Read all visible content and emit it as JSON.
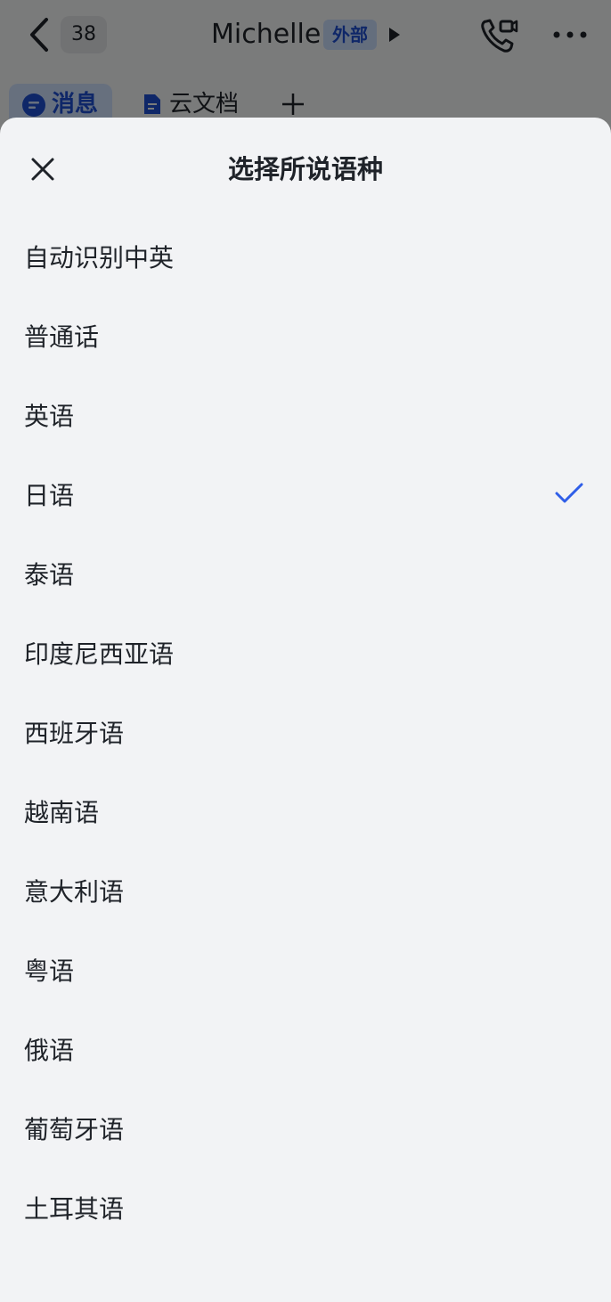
{
  "header": {
    "unread_count": "38",
    "contact_name": "Michelle",
    "external_tag": "外部"
  },
  "tabs": [
    {
      "label": "消息",
      "active": true
    },
    {
      "label": "云文档",
      "active": false
    }
  ],
  "sheet": {
    "title": "选择所说语种",
    "selected": "日语",
    "accent_color": "#2f5ee8",
    "options": [
      {
        "label": "自动识别中英"
      },
      {
        "label": "普通话"
      },
      {
        "label": "英语"
      },
      {
        "label": "日语"
      },
      {
        "label": "泰语"
      },
      {
        "label": "印度尼西亚语"
      },
      {
        "label": "西班牙语"
      },
      {
        "label": "越南语"
      },
      {
        "label": "意大利语"
      },
      {
        "label": "粤语"
      },
      {
        "label": "俄语"
      },
      {
        "label": "葡萄牙语"
      },
      {
        "label": "土耳其语"
      }
    ]
  }
}
